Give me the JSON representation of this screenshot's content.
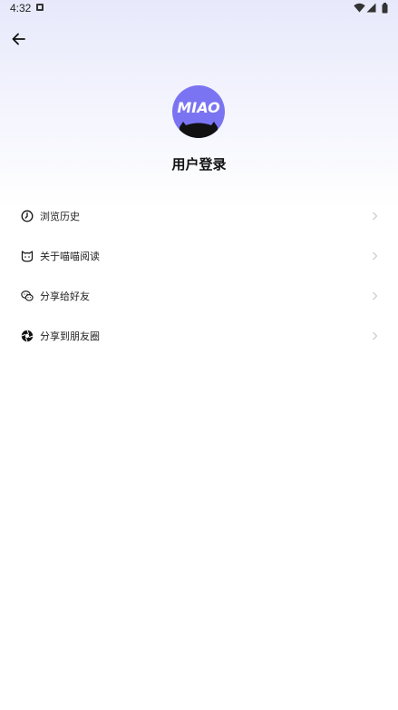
{
  "status_bar": {
    "time": "4:32"
  },
  "header": {
    "back_icon": "arrow-left-icon"
  },
  "profile": {
    "avatar_text": "MIAO",
    "avatar_color": "#7b74f2",
    "login_label": "用户登录"
  },
  "menu": {
    "items": [
      {
        "label": "浏览历史",
        "icon": "clock-icon"
      },
      {
        "label": "关于喵喵阅读",
        "icon": "cat-face-icon"
      },
      {
        "label": "分享给好友",
        "icon": "wechat-icon"
      },
      {
        "label": "分享到朋友圈",
        "icon": "moments-icon"
      }
    ]
  }
}
